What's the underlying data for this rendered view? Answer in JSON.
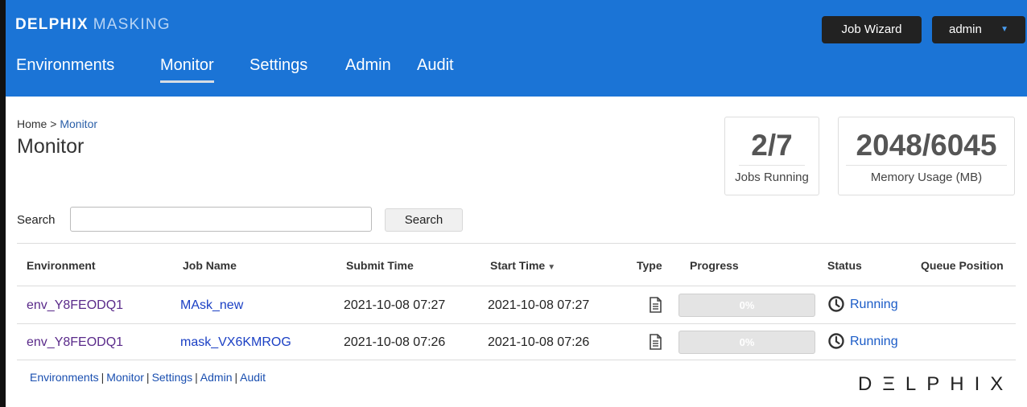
{
  "header": {
    "brand_bold": "DELPHIX",
    "brand_light": "MASKING",
    "job_wizard_label": "Job Wizard",
    "user_label": "admin",
    "nav": [
      {
        "label": "Environments",
        "active": false
      },
      {
        "label": "Monitor",
        "active": true
      },
      {
        "label": "Settings",
        "active": false
      },
      {
        "label": "Admin",
        "active": false
      },
      {
        "label": "Audit",
        "active": false
      }
    ],
    "color": "#1b74d6"
  },
  "breadcrumb": {
    "home": "Home",
    "separator": ">",
    "current": "Monitor"
  },
  "page_title": "Monitor",
  "stats": {
    "jobs": {
      "value": "2/7",
      "label": "Jobs Running"
    },
    "memory": {
      "value": "2048/6045",
      "label": "Memory Usage (MB)"
    }
  },
  "search": {
    "label": "Search",
    "value": "",
    "placeholder": "",
    "button_label": "Search"
  },
  "table": {
    "columns": [
      "Environment",
      "Job Name",
      "Submit Time",
      "Start Time",
      "Type",
      "Progress",
      "Status",
      "Queue Position"
    ],
    "sort_indicator": "▼",
    "rows": [
      {
        "environment": "env_Y8FEODQ1",
        "job_name": "MAsk_new",
        "submit_time": "2021-10-08 07:27",
        "start_time": "2021-10-08 07:27",
        "type_icon": "document-icon",
        "progress": "0%",
        "status": "Running",
        "queue_position": ""
      },
      {
        "environment": "env_Y8FEODQ1",
        "job_name": "mask_VX6KMROG",
        "submit_time": "2021-10-08 07:26",
        "start_time": "2021-10-08 07:26",
        "type_icon": "document-icon",
        "progress": "0%",
        "status": "Running",
        "queue_position": ""
      }
    ]
  },
  "footer": {
    "links": [
      "Environments",
      "Monitor",
      "Settings",
      "Admin",
      "Audit"
    ],
    "separator": "|",
    "logo_text": "DΞLPHIX"
  }
}
